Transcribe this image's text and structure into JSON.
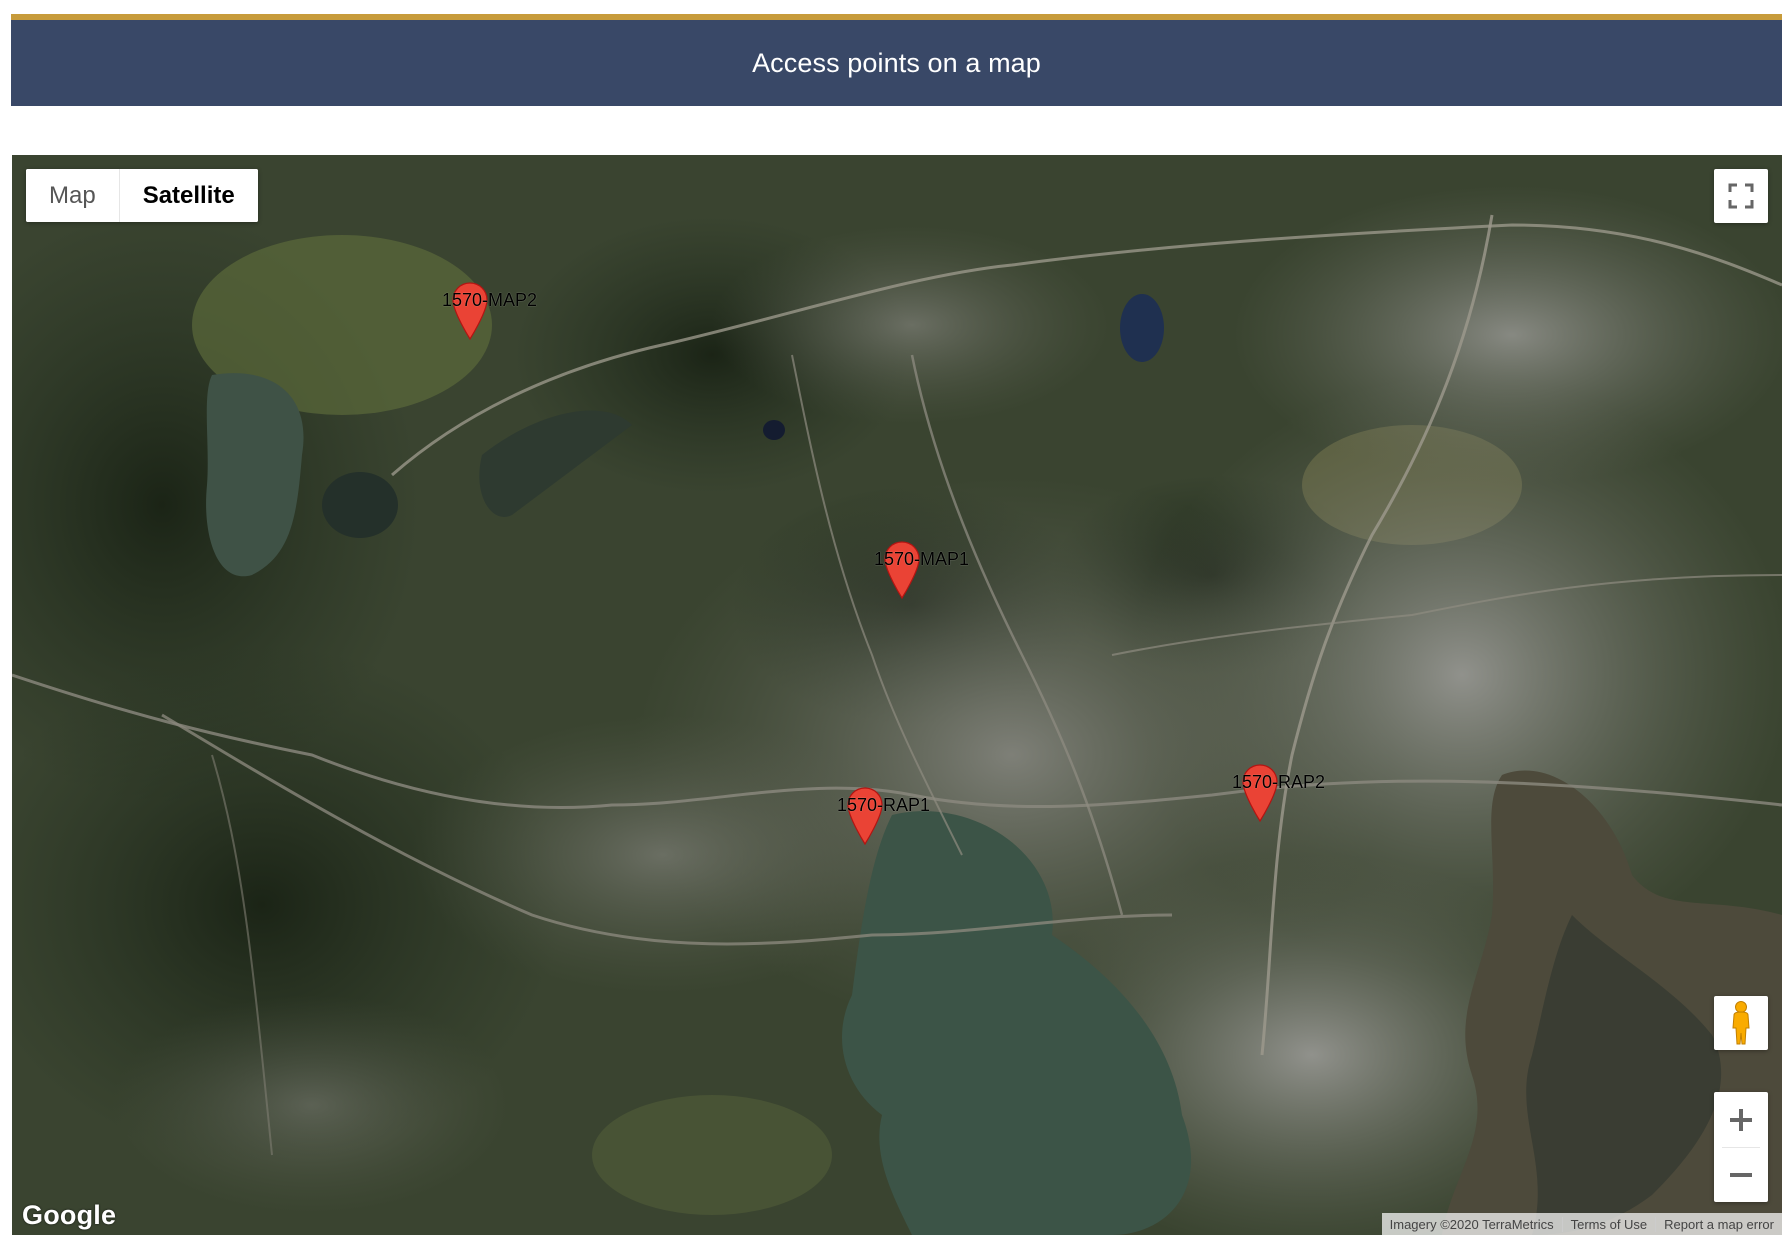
{
  "header": {
    "title": "Access points on a map",
    "bar_color": "#394867",
    "accent_color": "#c79b3b"
  },
  "map": {
    "type_buttons": [
      {
        "label": "Map",
        "active": false
      },
      {
        "label": "Satellite",
        "active": true
      }
    ],
    "markers": [
      {
        "label": "1570-MAP2"
      },
      {
        "label": "1570-MAP1"
      },
      {
        "label": "1570-RAP1"
      },
      {
        "label": "1570-RAP2"
      }
    ],
    "marker_color": "#ea4335",
    "logo": "Google",
    "attribution": {
      "imagery": "Imagery ©2020 TerraMetrics",
      "terms": "Terms of Use",
      "report": "Report a map error"
    },
    "icons": {
      "fullscreen": "fullscreen-icon",
      "pegman": "pegman-icon",
      "zoom_in": "plus-icon",
      "zoom_out": "minus-icon"
    }
  }
}
